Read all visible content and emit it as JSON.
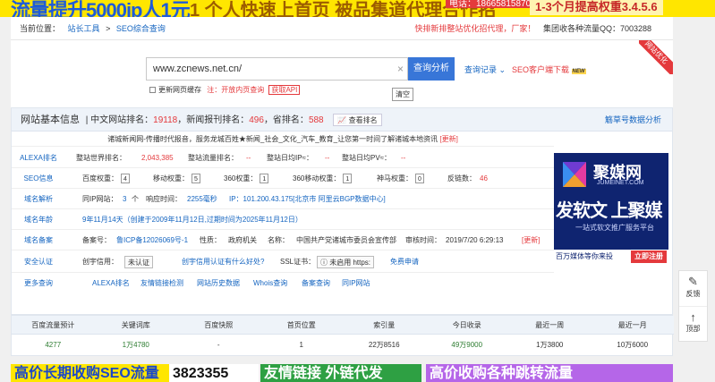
{
  "top_banner": {
    "left": "流量提升5000ip人1元",
    "mid": "1 个人快速上首页  被品集道代理合作招",
    "phone": "电话：18665815870",
    "right": "1-3个月提高权重3.4.5.6"
  },
  "crumb": {
    "label": "当前位置：",
    "item1": "站长工具",
    "sep1": ">",
    "item2": "SEO综合查询",
    "ad": "快排新排整站优化招代理，厂家！",
    "qq": "集团收各种流量QQ：7003288"
  },
  "search": {
    "value": "www.zcnews.net.cn/",
    "clear": "×",
    "button": "查询分析",
    "record": "查询记录",
    "seo_download": "SEO客户端下载",
    "new": "NEW",
    "tooltip": "清空",
    "update_cache": "更新网页缓存",
    "notice": "注：开放内页查询",
    "get_api": "获取API",
    "corner": "网站优化"
  },
  "panel": {
    "title": "网站基本信息",
    "rank_prefix": "| 中文网站排名：",
    "rank": "19118",
    "news_prefix": "，新闻报刊排名：",
    "news": "496",
    "prov_prefix": "，省排名：",
    "prov": "588",
    "rank_btn": "查看排名",
    "right_link": "觞草号数据分析",
    "desc": "诸城新闻网-传播时代报音，服务龙城百姓★新闻_社会_文化_汽车_教育_让您第一时间了解诸城本地资讯",
    "update": "[更新]"
  },
  "rows": {
    "alexa": {
      "label": "ALEXA排名",
      "world": "整站世界排名：",
      "world_v": "2,043,385",
      "flow": "整站流量排名：",
      "flow_v": "--",
      "ip": "整站日均IP≈：",
      "ip_v": "--",
      "pv": "整站日均PV≈：",
      "pv_v": "--"
    },
    "seo": {
      "label": "SEO信息",
      "baidu": "百度权重：",
      "baidu_v": "4",
      "mobile": "移动权重：",
      "mobile_v": "5",
      "s360": "360权重：",
      "s360_v": "1",
      "m360": "360移动权重：",
      "m360_v": "1",
      "shenma": "神马权重：",
      "shenma_v": "0",
      "backlink": "反链数：",
      "backlink_v": "46"
    },
    "dns": {
      "label": "域名解析",
      "same_ip": "同IP网站：",
      "same_ip_v": "3",
      "same_ip_u": "个",
      "resp": "响应时间：",
      "resp_v": "2255毫秒",
      "ip": "IP：101.200.43.175[北京市 阿里云BGP数据中心]"
    },
    "age": {
      "label": "域名年龄",
      "text": "9年11月14天（创建于2009年11月12日,过期时间为2025年11月12日）"
    },
    "icp": {
      "label": "域名备案",
      "no": "备案号：",
      "no_v": "鲁ICP备12026069号-1",
      "nature": "性质：",
      "nature_v": "政府机关",
      "name": "名称：",
      "name_v": "中国共产党诸城市委员会宣传部",
      "time": "审核时间：",
      "time_v": "2019/7/20 6:29:13",
      "update": "[更新]"
    },
    "safe": {
      "label": "安全认证",
      "cs": "创宇信用：",
      "cs_badge": "未认证",
      "cs_link": "创宇信用认证有什么好处?",
      "ssl": "SSL证书：",
      "ssl_badge": "未启用 https:",
      "ssl_link": "免费申请"
    },
    "more": {
      "label": "更多查询",
      "l1": "ALEXA排名",
      "l2": "友情链接检测",
      "l3": "网站历史数据",
      "l4": "Whois查询",
      "l5": "备案查询",
      "l6": "同IP网站"
    }
  },
  "side_ad": {
    "t1": "聚媒网",
    "t2": "JUMEINET.COM",
    "t3": "发软文 上聚媒",
    "t4": "一站式软文推广服务平台",
    "t5": "百万媒体等你来投",
    "t6": "立即注册"
  },
  "stats": {
    "headers": [
      "百度流量预计",
      "关键词库",
      "百度快照",
      "首页位置",
      "索引量",
      "今日收录",
      "最近一周",
      "最近一月"
    ],
    "values": [
      "4277",
      "1万4780",
      "-",
      "1",
      "22万8516",
      "49万9000",
      "1万3800",
      "10万6000"
    ]
  },
  "bottom_ads": {
    "a1": "高价长期收购SEO流量",
    "a2": "3823355",
    "a3": "友情链接   外链代发",
    "a4": "高价收购各种跳转流量"
  },
  "float_tools": {
    "feedback": "反馈",
    "top": "顶部"
  }
}
